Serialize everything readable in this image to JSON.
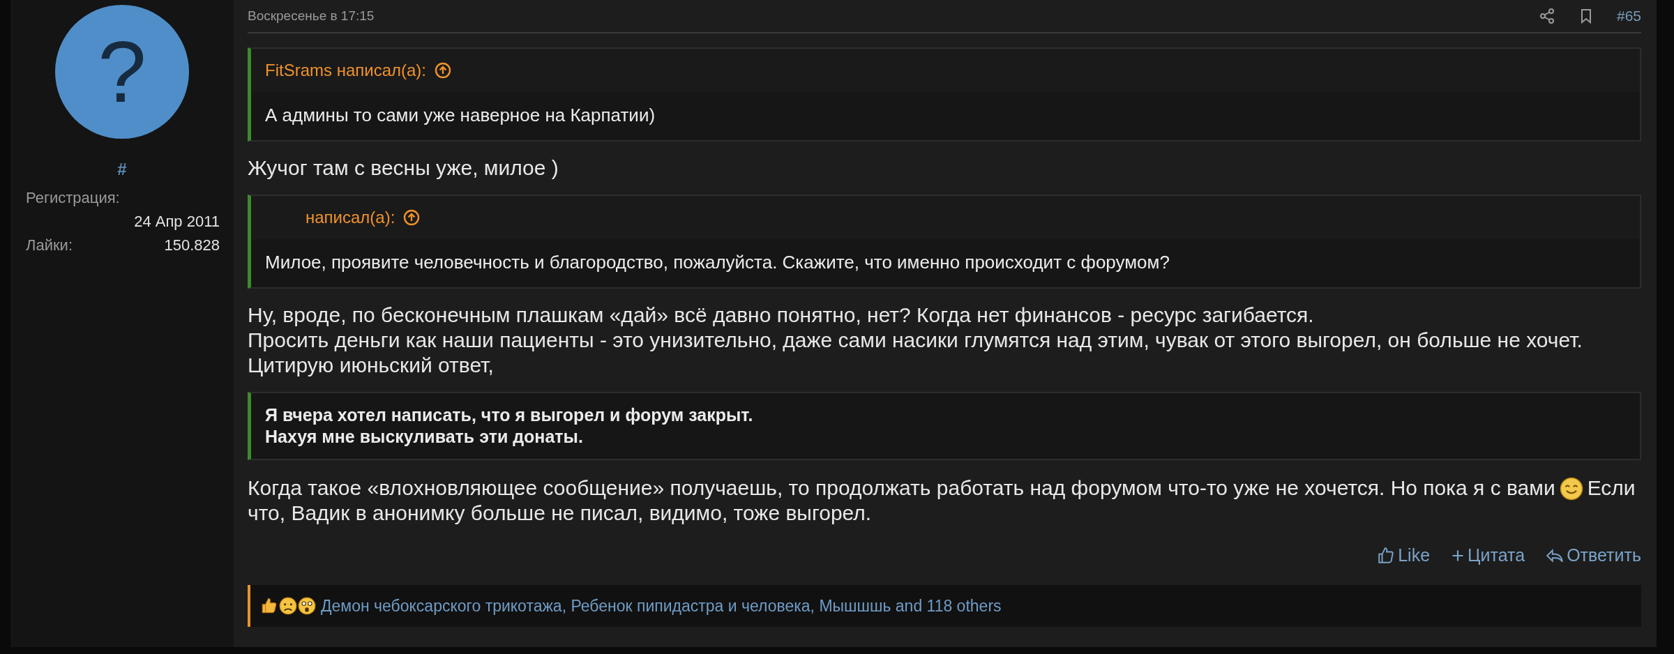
{
  "user": {
    "avatar_glyph": "?",
    "name": "#",
    "stats": [
      {
        "label": "Регистрация:",
        "value": "24 Апр 2011",
        "kind": "stacked"
      },
      {
        "label": "Лайки:",
        "value": "150.828",
        "kind": "inline"
      }
    ]
  },
  "post": {
    "date": "Воскресенье в 17:15",
    "number": "#65",
    "blocks": [
      {
        "kind": "quote",
        "author": "FitSrams",
        "said": "написал(а):",
        "lines": [
          "А админы то сами уже наверное на Карпатии)"
        ]
      },
      {
        "kind": "text",
        "lines": [
          "Жучог там с весны уже, милое )"
        ]
      },
      {
        "kind": "quote",
        "said": "написал(а):",
        "lines": [
          "Милое, проявите человечность и благородство, пожалуйста. Скажите, что именно происходит с форумом?"
        ]
      },
      {
        "kind": "text",
        "lines": [
          "Ну, вроде, по бесконечным плашкам «дай» всё давно понятно, нет? Когда нет финансов - ресурс загибается.",
          "Просить деньги как наши пациенты - это унизительно, даже сами насики глумятся над этим, чувак от этого выгорел, он больше не хочет.",
          "Цитирую июньский ответ,"
        ]
      },
      {
        "kind": "plain_quote",
        "lines": [
          "Я вчера хотел написать, что я выгорел и форум закрыт.",
          "Нахуя мне выскуливать эти донаты."
        ]
      },
      {
        "kind": "emoji_text",
        "before": "Когда такое «влохновляющее сообщение» получаешь, то продолжать работать над форумом что-то уже не хочется. Но пока я с вами",
        "after": "Если что, Вадик в анонимку больше не писал, видимо, тоже выгорел."
      }
    ],
    "actions": [
      {
        "kind": "like",
        "label": "Like"
      },
      {
        "kind": "quote",
        "label": "Цитата"
      },
      {
        "kind": "reply",
        "label": "Ответить"
      }
    ],
    "reactions": {
      "text": "Демон чебоксарского трикотажа, Ребенок пипидастра и человека, Мышшшь and 118 others"
    }
  }
}
